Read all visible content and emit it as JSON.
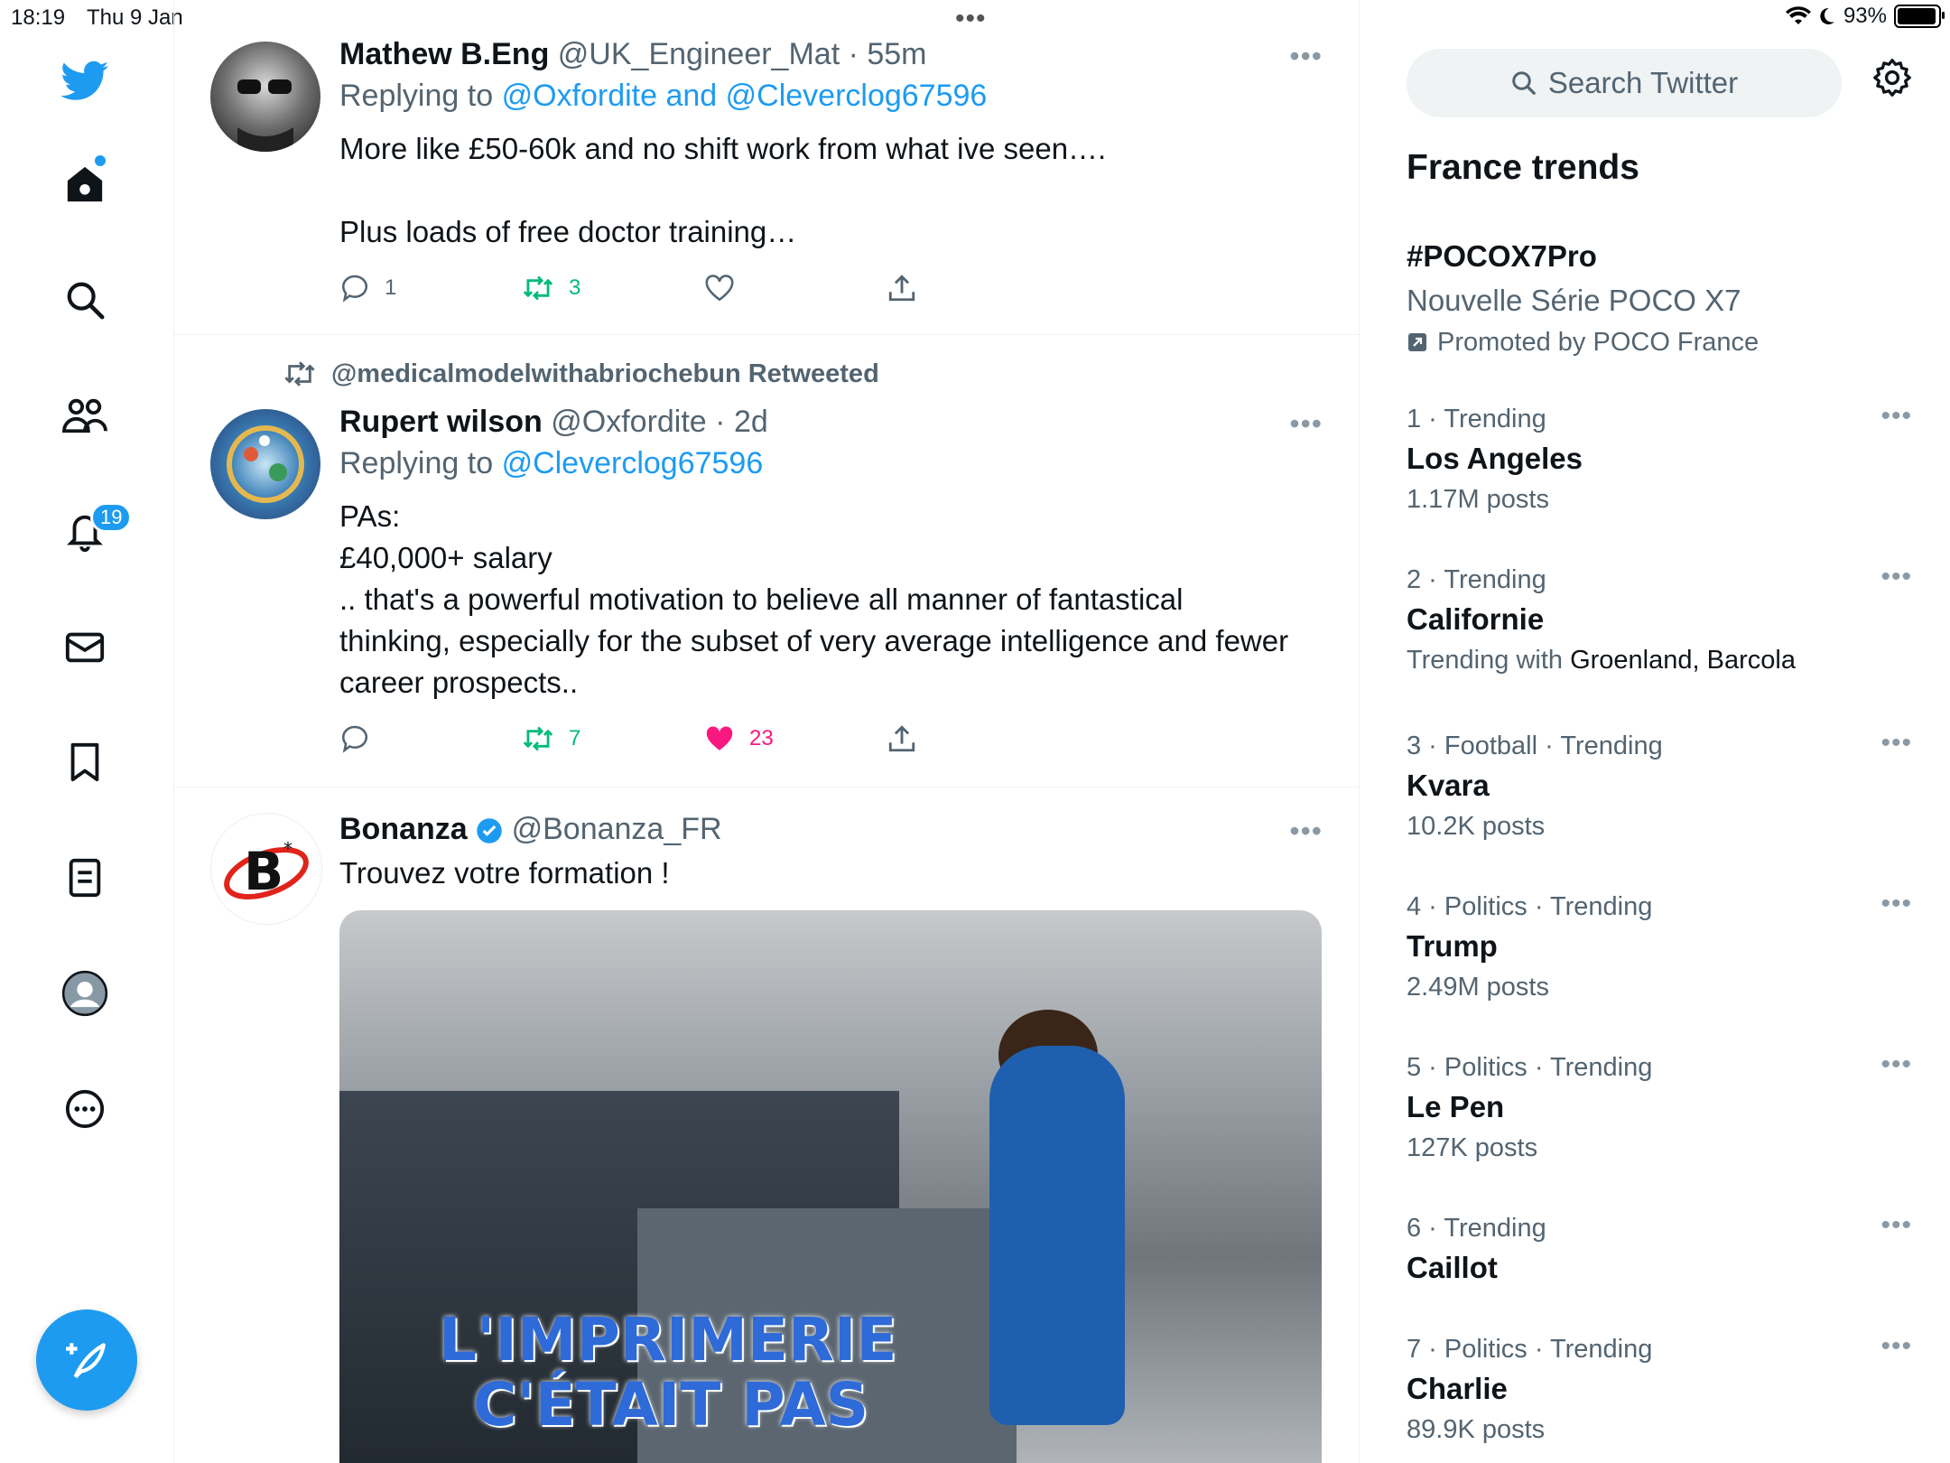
{
  "status_bar": {
    "time": "18:19",
    "date": "Thu 9 Jan",
    "battery": "93%",
    "battery_level": 0.93
  },
  "nav": {
    "items": [
      "twitter-logo",
      "home",
      "explore",
      "communities",
      "notifications",
      "messages",
      "bookmarks",
      "lists",
      "profile",
      "more"
    ],
    "notification_count": "19"
  },
  "tweets": [
    {
      "name": "Mathew B.Eng",
      "handle": "@UK_Engineer_Mat",
      "time": "· 55m",
      "reply_prefix": "Replying to",
      "reply_to": "@Oxfordite and @Cleverclog67596",
      "lines": [
        "More like £50-60k and no shift work from what ive seen….",
        "",
        "Plus loads of free doctor training…"
      ],
      "replies": "1",
      "retweets": "3",
      "likes": ""
    },
    {
      "retweeted_by": "@medicalmodelwithabriochebun Retweeted",
      "name": "Rupert wilson",
      "handle": "@Oxfordite",
      "time": "· 2d",
      "reply_prefix": "Replying to",
      "reply_to": "@Cleverclog67596",
      "lines": [
        "PAs:",
        "£40,000+ salary",
        ".. that's a powerful motivation to believe all manner of fantastical",
        "thinking, especially for the subset of very average intelligence and fewer",
        "career prospects.."
      ],
      "replies": "",
      "retweets": "7",
      "likes": "23"
    },
    {
      "name": "Bonanza",
      "handle": "@Bonanza_FR",
      "text": "Trouvez votre formation !",
      "media_caption_1": "L'IMPRIMERIE",
      "media_caption_2": "C'ÉTAIT PAS"
    }
  ],
  "sidebar": {
    "search_placeholder": "Search Twitter",
    "title": "France trends",
    "promoted": {
      "tag": "#POCOX7Pro",
      "subtitle": "Nouvelle Série POCO X7",
      "by": "Promoted by POCO France"
    },
    "trends": [
      {
        "meta": "1 · Trending",
        "name": "Los Angeles",
        "sub": "1.17M posts"
      },
      {
        "meta": "2 · Trending",
        "name": "Californie",
        "sub_prefix": "Trending with",
        "sub_names": "Groenland, Barcola"
      },
      {
        "meta": "3 · Football · Trending",
        "name": "Kvara",
        "sub": "10.2K posts"
      },
      {
        "meta": "4 · Politics · Trending",
        "name": "Trump",
        "sub": "2.49M posts"
      },
      {
        "meta": "5 · Politics · Trending",
        "name": "Le Pen",
        "sub": "127K posts"
      },
      {
        "meta": "6 · Trending",
        "name": "Caillot",
        "sub": ""
      },
      {
        "meta": "7 · Politics · Trending",
        "name": "Charlie",
        "sub": "89.9K posts"
      }
    ]
  },
  "colors": {
    "accent": "#1d9bf0",
    "retweet": "#00ba7c",
    "like": "#f91880",
    "muted": "#536471"
  }
}
